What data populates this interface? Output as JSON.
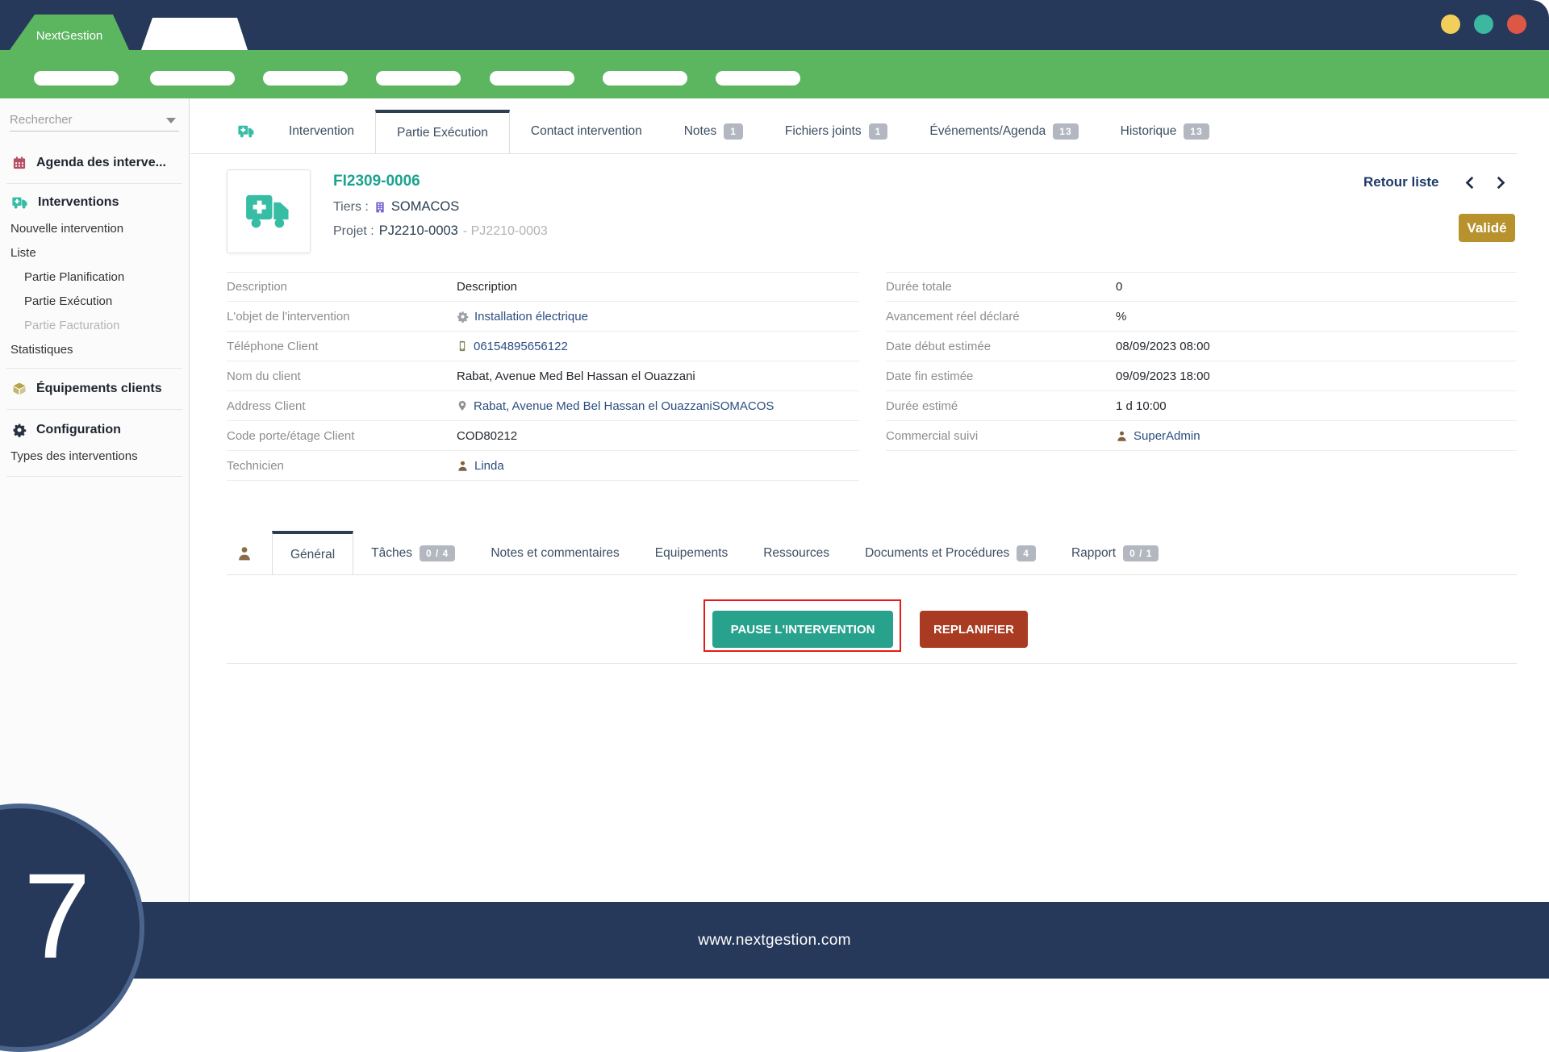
{
  "brand": "NextGestion",
  "colors": {
    "navy": "#26395a",
    "green": "#5cb660",
    "teal_icon": "#36bda4",
    "teal_button": "#28a18d",
    "brick_button": "#a83b22",
    "gold_badge": "#b8922d",
    "badge_gray": "#b2b7c0",
    "highlight_red": "#e41b17",
    "window_dots": [
      "#f2cf5b",
      "#3cb8a0",
      "#dd5746"
    ]
  },
  "sidebar": {
    "search_placeholder": "Rechercher",
    "agenda_label": "Agenda des interve...",
    "interventions_label": "Interventions",
    "items": {
      "nouvelle": "Nouvelle intervention",
      "liste": "Liste",
      "partie_planification": "Partie Planification",
      "partie_execution": "Partie Exécution",
      "partie_facturation": "Partie Facturation",
      "statistiques": "Statistiques",
      "equipements_clients": "Équipements clients",
      "configuration": "Configuration",
      "types_interventions": "Types des interventions"
    },
    "icons": [
      "calendar-icon",
      "truck-icon",
      "box-icon",
      "gear-icon"
    ]
  },
  "main_tabs": {
    "items": [
      {
        "label": "Intervention"
      },
      {
        "label": "Partie Exécution",
        "active": true
      },
      {
        "label": "Contact intervention"
      },
      {
        "label": "Notes",
        "badge": "1"
      },
      {
        "label": "Fichiers joints",
        "badge": "1"
      },
      {
        "label": "Événements/Agenda",
        "badge": "13"
      },
      {
        "label": "Historique",
        "badge": "13"
      }
    ]
  },
  "header": {
    "reference": "FI2309-0006",
    "tiers_label": "Tiers :",
    "tiers_value": "SOMACOS",
    "projet_label": "Projet :",
    "projet_value": "PJ2210-0003",
    "projet_secondary": "- PJ2210-0003",
    "retour_liste": "Retour liste",
    "status_badge": "Validé",
    "icons": [
      "ambulance-truck-icon",
      "building-icon",
      "chevron-left-icon",
      "chevron-right-icon"
    ]
  },
  "details_left": {
    "rows": [
      {
        "label": "Description",
        "value": "Description"
      },
      {
        "label": "L'objet de l'intervention",
        "value": "Installation électrique",
        "icon": "gear-icon"
      },
      {
        "label": "Téléphone Client",
        "value": "06154895656122",
        "icon": "phone-icon"
      },
      {
        "label": "Nom du client",
        "value": "Rabat, Avenue Med Bel Hassan el Ouazzani"
      },
      {
        "label": "Address Client",
        "value": "Rabat, Avenue Med Bel Hassan el OuazzaniSOMACOS",
        "icon": "pin-icon"
      },
      {
        "label": "Code porte/étage Client",
        "value": "COD80212"
      },
      {
        "label": "Technicien",
        "value": "Linda",
        "icon": "person-icon"
      }
    ]
  },
  "details_right": {
    "rows": [
      {
        "label": "Durée totale",
        "value": "0"
      },
      {
        "label": "Avancement réel déclaré",
        "value": "%"
      },
      {
        "label": "Date début estimée",
        "value": "08/09/2023 08:00"
      },
      {
        "label": "Date fin estimée",
        "value": "09/09/2023 18:00"
      },
      {
        "label": "Durée estimé",
        "value": "1 d 10:00"
      },
      {
        "label": "Commercial suivi",
        "value": "SuperAdmin",
        "icon": "person-icon"
      }
    ]
  },
  "sub_tabs": {
    "items": [
      {
        "label": "Général",
        "active": true
      },
      {
        "label": "Tâches",
        "badge": "0 / 4"
      },
      {
        "label": "Notes et commentaires"
      },
      {
        "label": "Equipements"
      },
      {
        "label": "Ressources"
      },
      {
        "label": "Documents et Procédures",
        "badge": "4"
      },
      {
        "label": "Rapport",
        "badge": "0 / 1"
      }
    ]
  },
  "actions": {
    "pause": "PAUSE L'INTERVENTION",
    "replanifier": "REPLANIFIER"
  },
  "footer": {
    "url": "www.nextgestion.com",
    "page_number": "7"
  }
}
